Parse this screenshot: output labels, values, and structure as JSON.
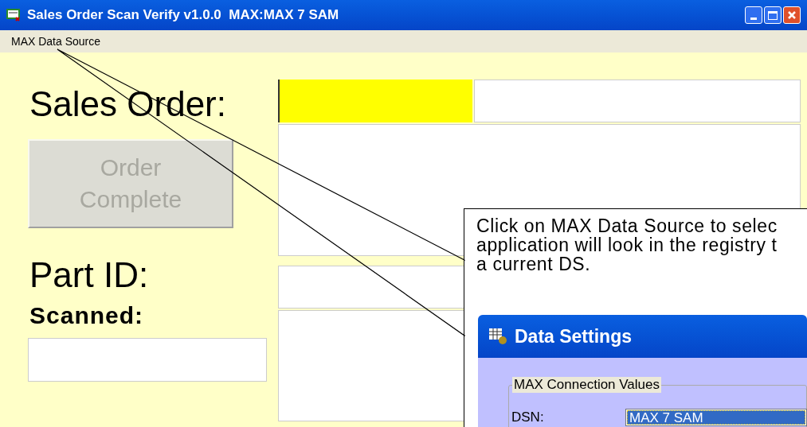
{
  "window": {
    "title": "Sales Order Scan Verify v1.0.0  MAX:MAX 7 SAM"
  },
  "menu": [
    "MAX Data Source"
  ],
  "form": {
    "sales_order_label": "Sales Order:",
    "order_complete": {
      "label": "Order Complete",
      "disabled": true
    },
    "part_id_label": "Part ID:",
    "scanned_label": "Scanned:"
  },
  "callout": {
    "text": "Click on MAX Data Source to selec\napplication will look in the registry t\na current DS."
  },
  "dialog": {
    "title": "Data Settings",
    "group": "MAX Connection Values",
    "dsn_label": "DSN:",
    "dsn_value": "MAX 7 SAM",
    "dsn_selected": true
  }
}
